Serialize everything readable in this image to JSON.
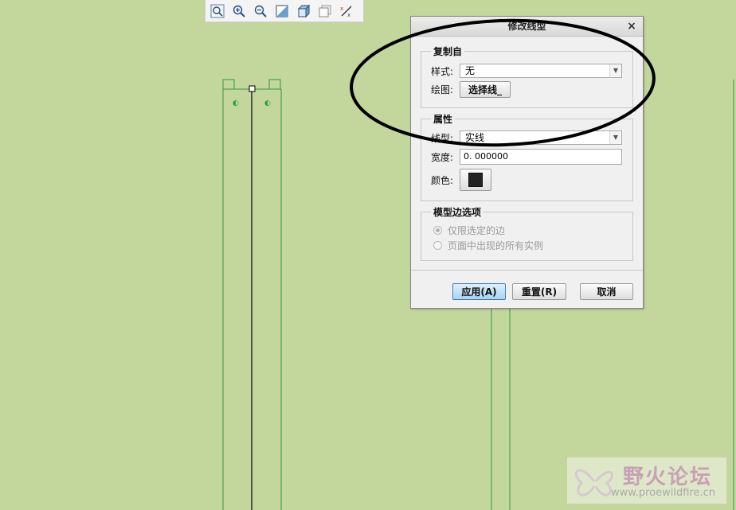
{
  "dialog": {
    "title": "修改线型",
    "close_glyph": "×",
    "copy_from": {
      "group_title": "复制自",
      "style_label": "样式:",
      "style_value": "无",
      "drawing_label": "绘图:",
      "select_line_button": "选择线_"
    },
    "attributes": {
      "group_title": "属性",
      "linetype_label": "线型:",
      "linetype_value": "实线",
      "width_label": "宽度:",
      "width_value": "0. 000000",
      "color_label": "颜色:",
      "color_value": "#222222"
    },
    "model_edge_options": {
      "group_title": "模型边选项",
      "options": [
        {
          "label": "仅限选定的边",
          "selected": true
        },
        {
          "label": "页面中出现的所有实例",
          "selected": false
        }
      ]
    },
    "buttons": {
      "apply": "应用(A)",
      "reset": "重置(R)",
      "cancel": "取消"
    }
  },
  "toolbar": {
    "icons": [
      "zoom-refit-icon",
      "zoom-in-icon",
      "zoom-out-icon",
      "repaint-icon",
      "view-3d-icon",
      "layer-icon",
      "display-toggle-icon"
    ]
  },
  "watermark": {
    "brand": "野火论坛",
    "url": "www.proewildfire.cn"
  },
  "colors": {
    "canvas_bg": "#c3d69b",
    "model_line": "#2e9a44",
    "apply_accent": "#a6d4f2"
  }
}
